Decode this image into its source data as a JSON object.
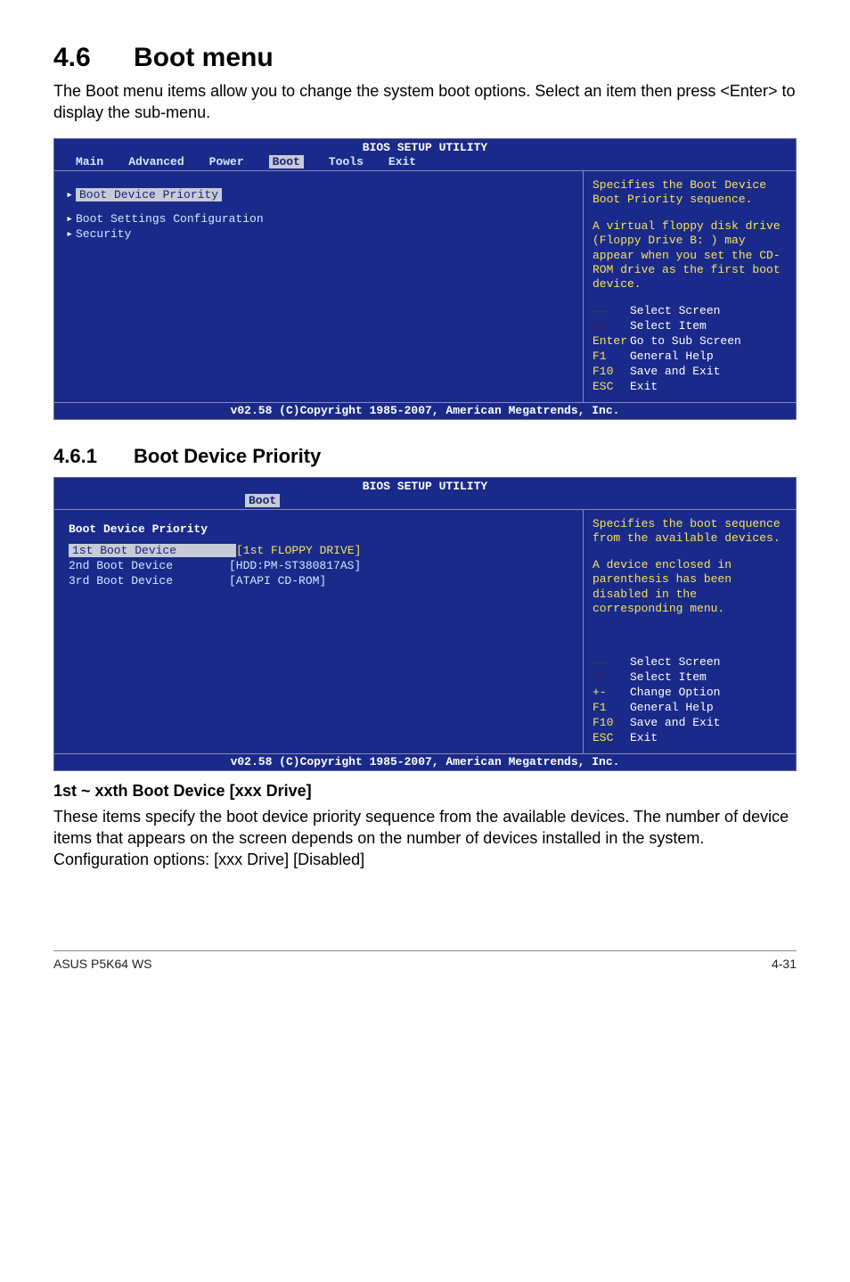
{
  "section": {
    "num": "4.6",
    "title": "Boot menu"
  },
  "intro": "The Boot menu items allow you to change the system boot options. Select an item then press <Enter> to display the sub-menu.",
  "bios1": {
    "title": "BIOS SETUP UTILITY",
    "tabs": [
      "Main",
      "Advanced",
      "Power",
      "Boot",
      "Tools",
      "Exit"
    ],
    "items": [
      {
        "label": "Boot Device Priority",
        "selected": true
      },
      {
        "label": "Boot Settings Configuration"
      },
      {
        "label": "Security"
      }
    ],
    "help1": "Specifies the Boot Device Boot Priority sequence.",
    "help2": "A virtual floppy disk drive (Floppy Drive B: ) may appear when you set the CD-ROM drive as the first boot device.",
    "keys": [
      {
        "sym": "←→",
        "cls": "lr",
        "txt": "Select Screen"
      },
      {
        "sym": "↑↓",
        "cls": "ud",
        "txt": "Select Item"
      },
      {
        "sym": "Enter",
        "cls": "",
        "txt": "Go to Sub Screen"
      },
      {
        "sym": "F1",
        "cls": "",
        "txt": "General Help"
      },
      {
        "sym": "F10",
        "cls": "",
        "txt": "Save and Exit"
      },
      {
        "sym": "ESC",
        "cls": "",
        "txt": "Exit"
      }
    ],
    "footer": "v02.58 (C)Copyright 1985-2007, American Megatrends, Inc."
  },
  "subsection": {
    "num": "4.6.1",
    "title": "Boot Device Priority"
  },
  "bios2": {
    "title": "BIOS SETUP UTILITY",
    "tab": "Boot",
    "heading": "Boot Device Priority",
    "rows": [
      {
        "k": "1st Boot Device",
        "v": "[1st FLOPPY DRIVE]",
        "sel": true
      },
      {
        "k": "2nd Boot Device",
        "v": "[HDD:PM-ST380817AS]"
      },
      {
        "k": "3rd Boot Device",
        "v": "[ATAPI CD-ROM]"
      }
    ],
    "help1": "Specifies the boot sequence from the available devices.",
    "help2": "A device enclosed in parenthesis has been disabled in the corresponding menu.",
    "keys": [
      {
        "sym": "←→",
        "cls": "lr",
        "txt": "Select Screen"
      },
      {
        "sym": "↑↓",
        "cls": "ud",
        "txt": "Select Item"
      },
      {
        "sym": "+-",
        "cls": "pm",
        "txt": "Change Option"
      },
      {
        "sym": "F1",
        "cls": "",
        "txt": "General Help"
      },
      {
        "sym": "F10",
        "cls": "",
        "txt": "Save and Exit"
      },
      {
        "sym": "ESC",
        "cls": "",
        "txt": "Exit"
      }
    ],
    "footer": "v02.58 (C)Copyright 1985-2007, American Megatrends, Inc."
  },
  "sub_h": "1st ~ xxth Boot Device [xxx Drive]",
  "sub_p": "These items specify the boot device priority sequence from the available devices. The number of device items that appears on the screen depends on the number of devices installed in the system. Configuration options: [xxx Drive] [Disabled]",
  "footer": {
    "left": "ASUS P5K64 WS",
    "right": "4-31"
  }
}
